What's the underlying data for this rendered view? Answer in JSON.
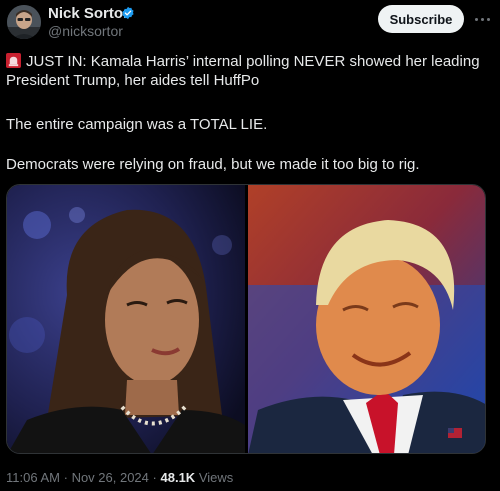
{
  "author": {
    "display_name": "Nick Sortor",
    "handle": "@nicksortor",
    "verified_icon": "verified-badge-icon"
  },
  "actions": {
    "subscribe_label": "Subscribe",
    "more_icon": "more-options-icon"
  },
  "tweet": {
    "siren_icon": "rotating-light-emoji",
    "paragraph1": "JUST IN: Kamala Harris’ internal polling NEVER showed her leading President Trump, her aides tell HuffPo",
    "paragraph2": "The entire campaign was a TOTAL LIE.",
    "paragraph3": "Democrats were relying on fraud, but we made it too big to rig."
  },
  "meta": {
    "time": "11:06 AM",
    "separator": "·",
    "date": "Nov 26, 2024",
    "views_count": "48.1K",
    "views_label": "Views"
  },
  "colors": {
    "background": "#000000",
    "text": "#e7e9ea",
    "secondary_text": "#71767b",
    "verified_blue": "#1d9bf0",
    "subscribe_bg": "#eff3f4"
  }
}
